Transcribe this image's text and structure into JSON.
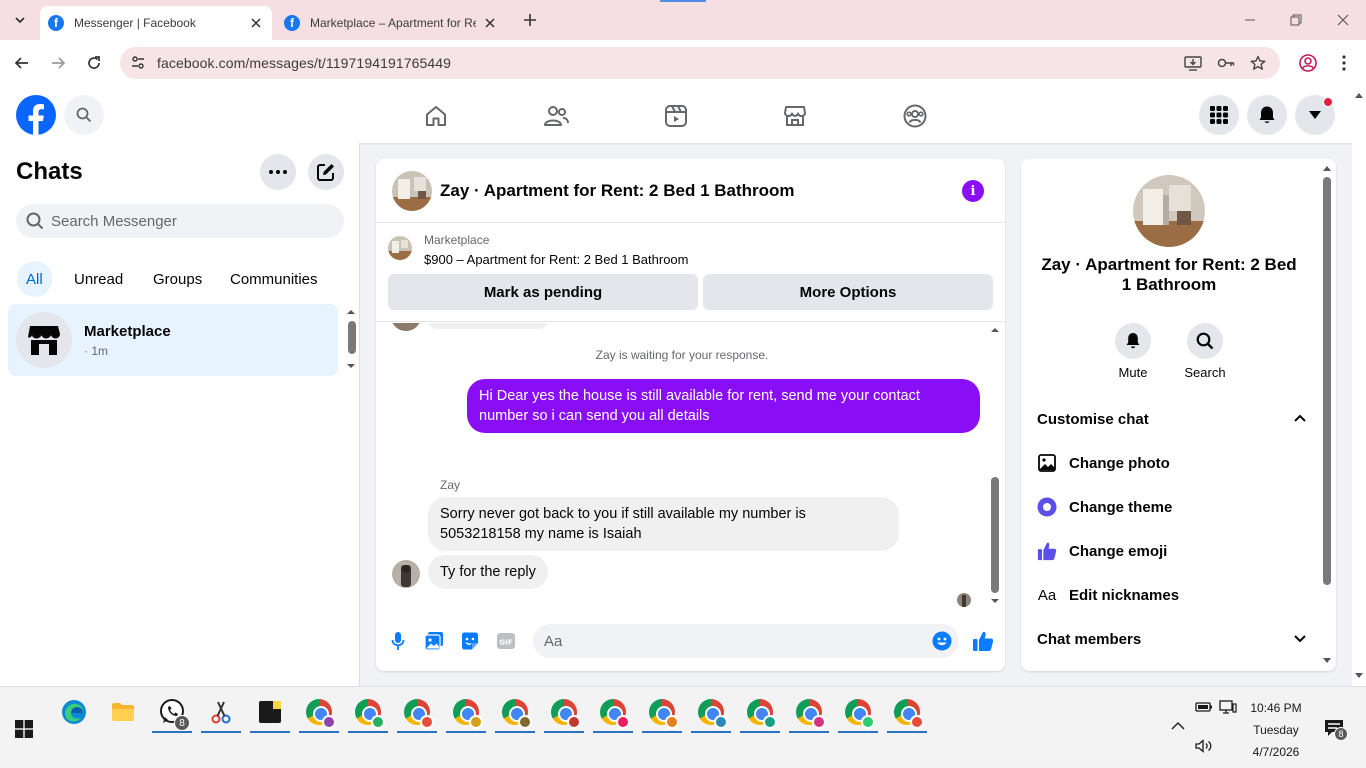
{
  "browser": {
    "tabs": [
      {
        "title": "Messenger | Facebook",
        "active": true
      },
      {
        "title": "Marketplace – Apartment for Re",
        "active": false
      }
    ],
    "url": "facebook.com/messages/t/1197194191765449"
  },
  "chats": {
    "title": "Chats",
    "search_placeholder": "Search Messenger",
    "filters": [
      "All",
      "Unread",
      "Groups",
      "Communities"
    ],
    "items": [
      {
        "name": "Marketplace",
        "subtitle": "· 1m"
      }
    ]
  },
  "conversation": {
    "title": "Zay · Apartment for Rent: 2 Bed 1 Bathroom",
    "marketplace_label": "Marketplace",
    "listing": "$900 – Apartment for Rent: 2 Bed 1 Bathroom",
    "buttons": {
      "pending": "Mark as pending",
      "more": "More Options"
    },
    "waiting_notice": "Zay is waiting for your response.",
    "outgoing": "Hi Dear yes the house is still available for rent, send me your contact number so i can send you all details",
    "sender": "Zay",
    "incoming": [
      "Sorry never got back to you if still available my number is 5053218158 my name is Isaiah",
      "Ty for the reply"
    ],
    "composer_placeholder": "Aa",
    "accent_color": "#8a0ef5"
  },
  "info_panel": {
    "name": "Zay · Apartment for Rent: 2 Bed 1 Bathroom",
    "actions": [
      {
        "label": "Mute",
        "icon": "bell-icon"
      },
      {
        "label": "Search",
        "icon": "search-icon"
      }
    ],
    "customise_heading": "Customise chat",
    "options": [
      {
        "label": "Change photo",
        "icon": "photo-icon"
      },
      {
        "label": "Change theme",
        "icon": "theme-icon"
      },
      {
        "label": "Change emoji",
        "icon": "thumbs-up-icon"
      },
      {
        "label": "Edit nicknames",
        "icon": "nickname-icon"
      }
    ],
    "members_heading": "Chat members"
  },
  "taskbar": {
    "whatsapp_badge": "8",
    "notification_badge": "8",
    "time": "10:46 PM",
    "day": "Tuesday",
    "date": "4/7/2026"
  }
}
